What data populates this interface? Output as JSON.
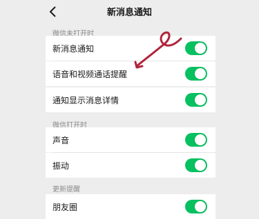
{
  "nav": {
    "title": "新消息通知",
    "back_icon": "chevron-left-icon"
  },
  "sections": [
    {
      "header": "微信未打开时",
      "items": [
        {
          "label": "新消息通知",
          "enabled": true
        },
        {
          "label": "语音和视频通话提醒",
          "enabled": true
        }
      ]
    },
    {
      "header": "",
      "items": [
        {
          "label": "通知显示消息详情",
          "enabled": true
        }
      ]
    },
    {
      "header": "微信打开时",
      "items": [
        {
          "label": "声音",
          "enabled": true
        },
        {
          "label": "振动",
          "enabled": true
        }
      ]
    },
    {
      "header": "更新提醒",
      "items": [
        {
          "label": "朋友圈",
          "enabled": true
        }
      ]
    }
  ],
  "colors": {
    "accent": "#07c160",
    "background": "#ededed",
    "annotation": "#b0233a"
  }
}
